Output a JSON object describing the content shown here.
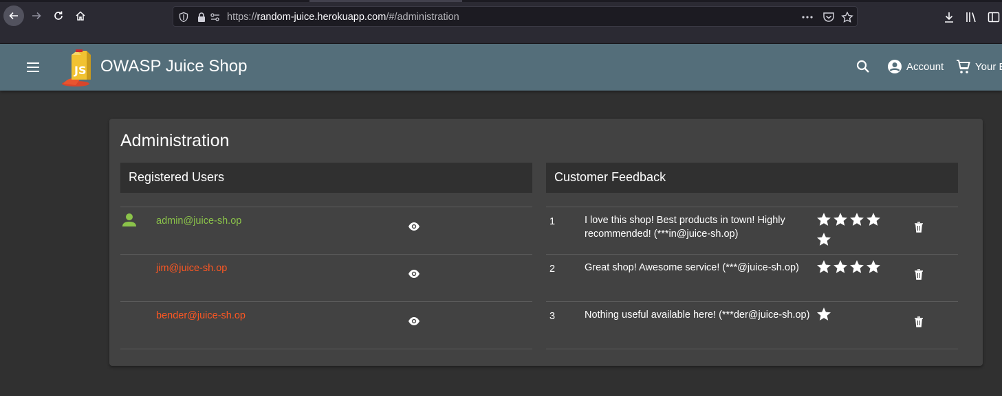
{
  "browser": {
    "url_prefix": "https://",
    "url_domain": "random-juice.herokuapp.com",
    "url_path": "/#/administration"
  },
  "app": {
    "title": "OWASP Juice Shop",
    "account_label": "Account",
    "basket_label": "Your Basket",
    "primary_color": "#546e7a"
  },
  "page": {
    "title": "Administration"
  },
  "users": {
    "heading": "Registered Users",
    "rows": [
      {
        "email": "admin@juice-sh.op",
        "color": "#8bc34a",
        "icon": "person-icon"
      },
      {
        "email": "jim@juice-sh.op",
        "color": "#ff5722"
      },
      {
        "email": "bender@juice-sh.op",
        "color": "#ff5722"
      }
    ]
  },
  "feedback": {
    "heading": "Customer Feedback",
    "rows": [
      {
        "id": "1",
        "comment": "I love this shop! Best products in town! Highly recommended! (***in@juice-sh.op)",
        "rating": 5
      },
      {
        "id": "2",
        "comment": "Great shop! Awesome service! (***@juice-sh.op)",
        "rating": 4
      },
      {
        "id": "3",
        "comment": "Nothing useful available here! (***der@juice-sh.op)",
        "rating": 1
      }
    ]
  }
}
